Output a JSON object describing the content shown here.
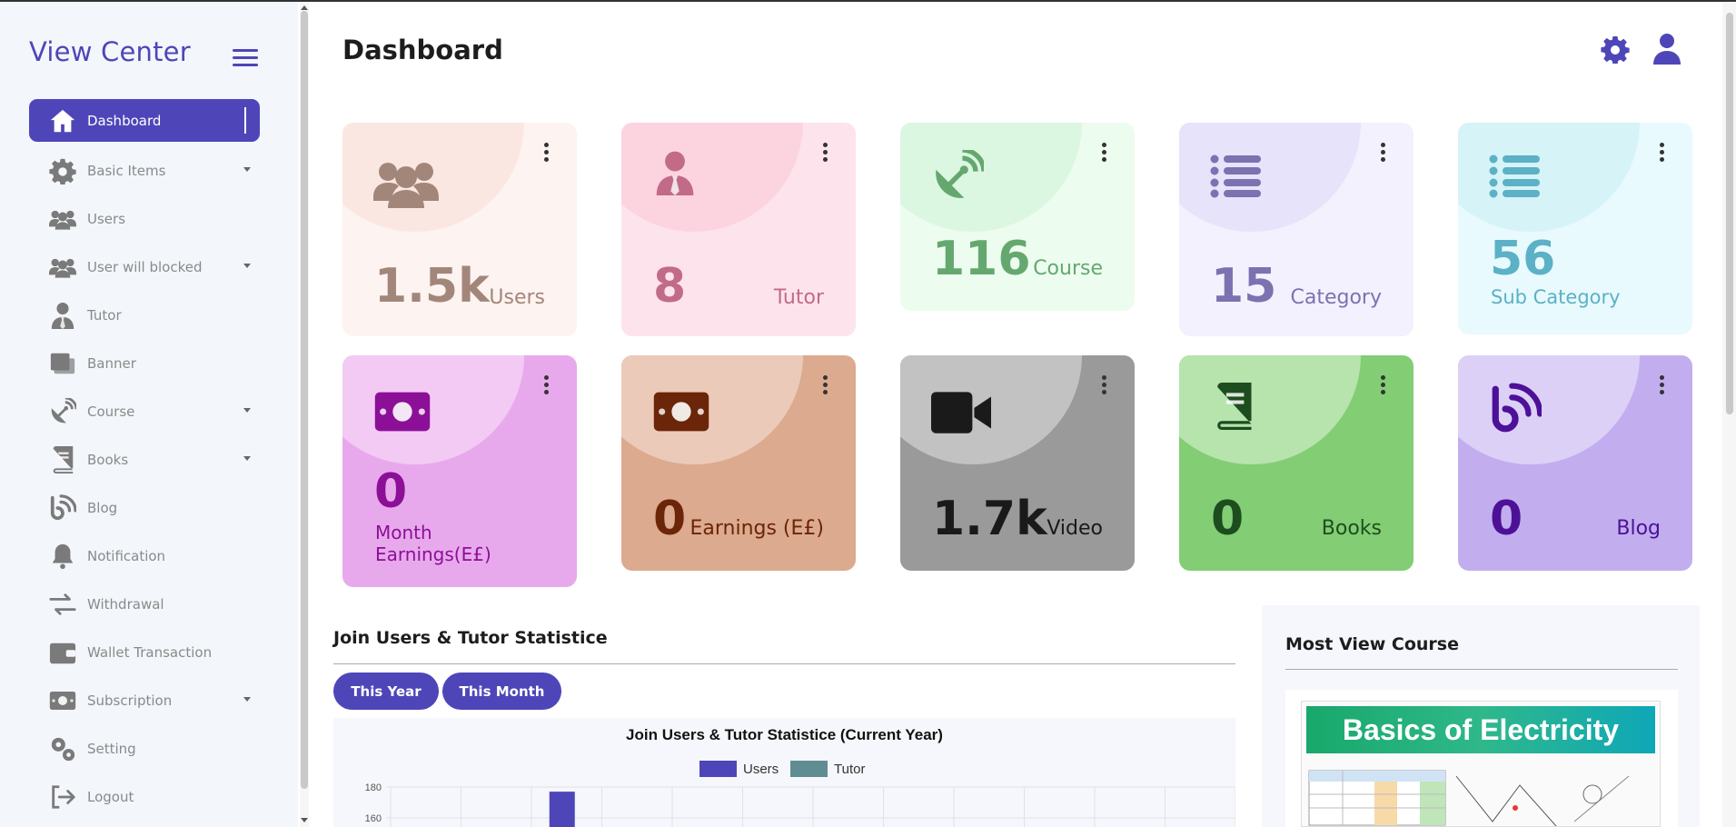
{
  "app": {
    "brand": "View Center"
  },
  "header": {
    "title": "Dashboard"
  },
  "sidebar": {
    "items": [
      {
        "label": "Dashboard",
        "icon": "home-icon",
        "active": true
      },
      {
        "label": "Basic Items",
        "icon": "gear-icon",
        "dropdown": true
      },
      {
        "label": "Users",
        "icon": "users-icon"
      },
      {
        "label": "User will blocked",
        "icon": "users-icon",
        "dropdown": true
      },
      {
        "label": "Tutor",
        "icon": "tutor-icon"
      },
      {
        "label": "Banner",
        "icon": "banner-icon"
      },
      {
        "label": "Course",
        "icon": "satellite-icon",
        "dropdown": true
      },
      {
        "label": "Books",
        "icon": "book-icon",
        "dropdown": true
      },
      {
        "label": "Blog",
        "icon": "blog-icon"
      },
      {
        "label": "Notification",
        "icon": "bell-icon"
      },
      {
        "label": "Withdrawal",
        "icon": "transfer-icon"
      },
      {
        "label": "Wallet Transaction",
        "icon": "wallet-icon"
      },
      {
        "label": "Subscription",
        "icon": "money-icon",
        "dropdown": true
      },
      {
        "label": "Setting",
        "icon": "gears-icon"
      },
      {
        "label": "Logout",
        "icon": "logout-icon"
      }
    ]
  },
  "cards": [
    {
      "value": "1.5k",
      "label": "Users",
      "icon": "users-icon",
      "bg": "#fdf3f0",
      "blob": "#fbe7e2",
      "color": "#a3867a"
    },
    {
      "value": "8",
      "label": "Tutor",
      "icon": "tutor-icon",
      "bg": "#fde4ec",
      "blob": "#fcd4e0",
      "color": "#c26b88"
    },
    {
      "value": "116",
      "label": "Course",
      "icon": "satellite-icon",
      "bg": "#ecfcef",
      "blob": "#dcf7e1",
      "color": "#65a86f"
    },
    {
      "value": "15",
      "label": "Category",
      "icon": "list-icon",
      "bg": "#f3f1fd",
      "blob": "#e7e3fb",
      "color": "#7c72b0"
    },
    {
      "value": "56",
      "label": "Sub Category",
      "icon": "list-icon",
      "bg": "#e8fafd",
      "blob": "#d6f3f8",
      "color": "#5cb1c6"
    },
    {
      "value": "0",
      "label": "Month Earnings(E£)",
      "icon": "money-icon",
      "bg": "#e8a9ec",
      "blob": "#f2caf4",
      "color": "#8c0f98"
    },
    {
      "value": "0",
      "label": "Earnings (E£)",
      "icon": "money-icon",
      "bg": "#dcaa8f",
      "blob": "#ebcab9",
      "color": "#6b2508"
    },
    {
      "value": "1.7k",
      "label": "Video",
      "icon": "video-icon",
      "bg": "#9a9a9a",
      "blob": "#c2c2c2",
      "color": "#1a1a1a"
    },
    {
      "value": "0",
      "label": "Books",
      "icon": "book-icon",
      "bg": "#83cd75",
      "blob": "#b7e3ad",
      "color": "#1d4d1e"
    },
    {
      "value": "0",
      "label": "Blog",
      "icon": "blog-icon",
      "bg": "#c2aeee",
      "blob": "#dcd0f7",
      "color": "#4d1198"
    }
  ],
  "stats": {
    "title": "Join Users & Tutor Statistice",
    "tabs": [
      "This Year",
      "This Month"
    ]
  },
  "chart_data": {
    "type": "bar",
    "title": "Join Users & Tutor Statistice (Current Year)",
    "series": [
      {
        "name": "Users",
        "color": "#4e46b8",
        "values": [
          0,
          0,
          177,
          0,
          0,
          0,
          0,
          0,
          0,
          0,
          0,
          0
        ]
      },
      {
        "name": "Tutor",
        "color": "#5f8d91",
        "values": [
          0,
          0,
          0,
          0,
          0,
          0,
          0,
          0,
          0,
          0,
          0,
          0
        ]
      }
    ],
    "yticks": [
      "180",
      "160"
    ],
    "ylim_visible": [
      160,
      180
    ],
    "grid": true,
    "legend": "top-center"
  },
  "most_view": {
    "title": "Most View Course",
    "course_title": "Basics of Electricity"
  }
}
